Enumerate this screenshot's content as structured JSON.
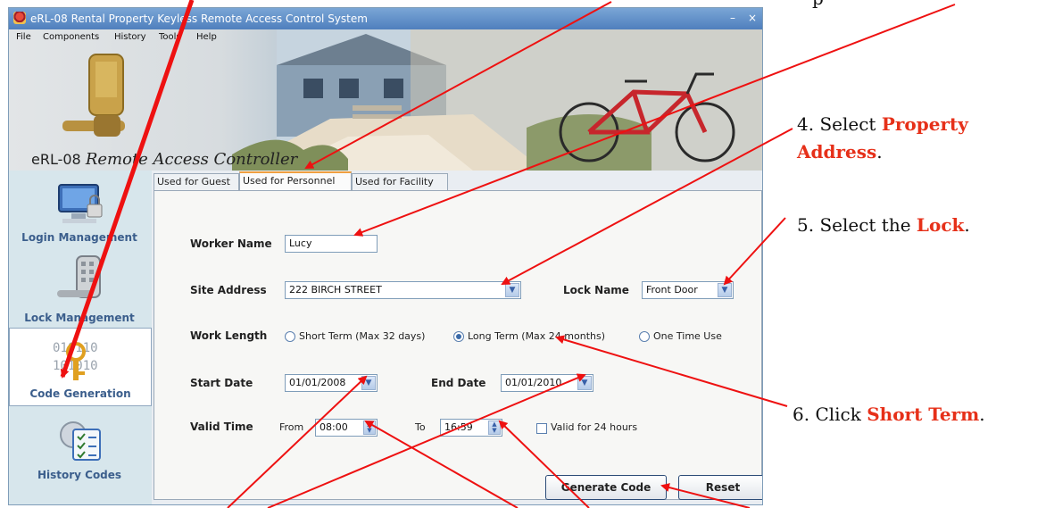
{
  "window": {
    "title": "eRL-08 Rental Property Keyless Remote Access Control System",
    "minimize_glyph": "–",
    "close_glyph": "×",
    "menu": [
      "File",
      "Components",
      "History",
      "Tools",
      "Help"
    ]
  },
  "banner": {
    "logo_prefix": "eRL-08",
    "logo_script": "Remote Access Controller"
  },
  "sidebar": {
    "items": [
      {
        "label": "Login Management",
        "icon": "computer-lock-icon"
      },
      {
        "label": "Lock Management",
        "icon": "keypad-lock-icon"
      },
      {
        "label": "Code Generation",
        "icon": "binary-key-icon",
        "active": true
      },
      {
        "label": "History Codes",
        "icon": "checklist-gear-icon"
      }
    ]
  },
  "tabs": [
    {
      "label": "Used for Guest"
    },
    {
      "label": "Used for Personnel",
      "active": true
    },
    {
      "label": "Used for Facility"
    }
  ],
  "form": {
    "worker_name_label": "Worker Name",
    "worker_name_value": "Lucy",
    "site_address_label": "Site Address",
    "site_address_value": "222 BIRCH STREET",
    "lock_name_label": "Lock Name",
    "lock_name_value": "Front Door",
    "work_length_label": "Work Length",
    "work_length_options": [
      {
        "label": "Short Term (Max 32 days)",
        "selected": false
      },
      {
        "label": "Long Term (Max 24 months)",
        "selected": true
      },
      {
        "label": "One Time Use",
        "selected": false
      }
    ],
    "start_date_label": "Start Date",
    "start_date_value": "01/01/2008",
    "end_date_label": "End Date",
    "end_date_value": "01/01/2010",
    "valid_time_label": "Valid Time",
    "from_label": "From",
    "from_value": "08:00",
    "to_label": "To",
    "to_value": "16:59",
    "valid_24_label": "Valid for 24 hours",
    "valid_24_checked": false,
    "generate_label": "Generate Code",
    "reset_label": "Reset"
  },
  "annotations": {
    "step4_prefix": "4. Select ",
    "step4_em1": "Property",
    "step4_em2": "Address",
    "step4_suffix": ".",
    "step5_prefix": "5. Select the ",
    "step5_em": "Lock",
    "step5_suffix": ".",
    "step6_prefix": "6. Click ",
    "step6_em": "Short Term",
    "step6_suffix": ".",
    "top_fragment": "p"
  },
  "colors": {
    "annotation_red": "#e63019",
    "arrow_red": "#ee1111",
    "nav_blue": "#3b5e8c"
  }
}
